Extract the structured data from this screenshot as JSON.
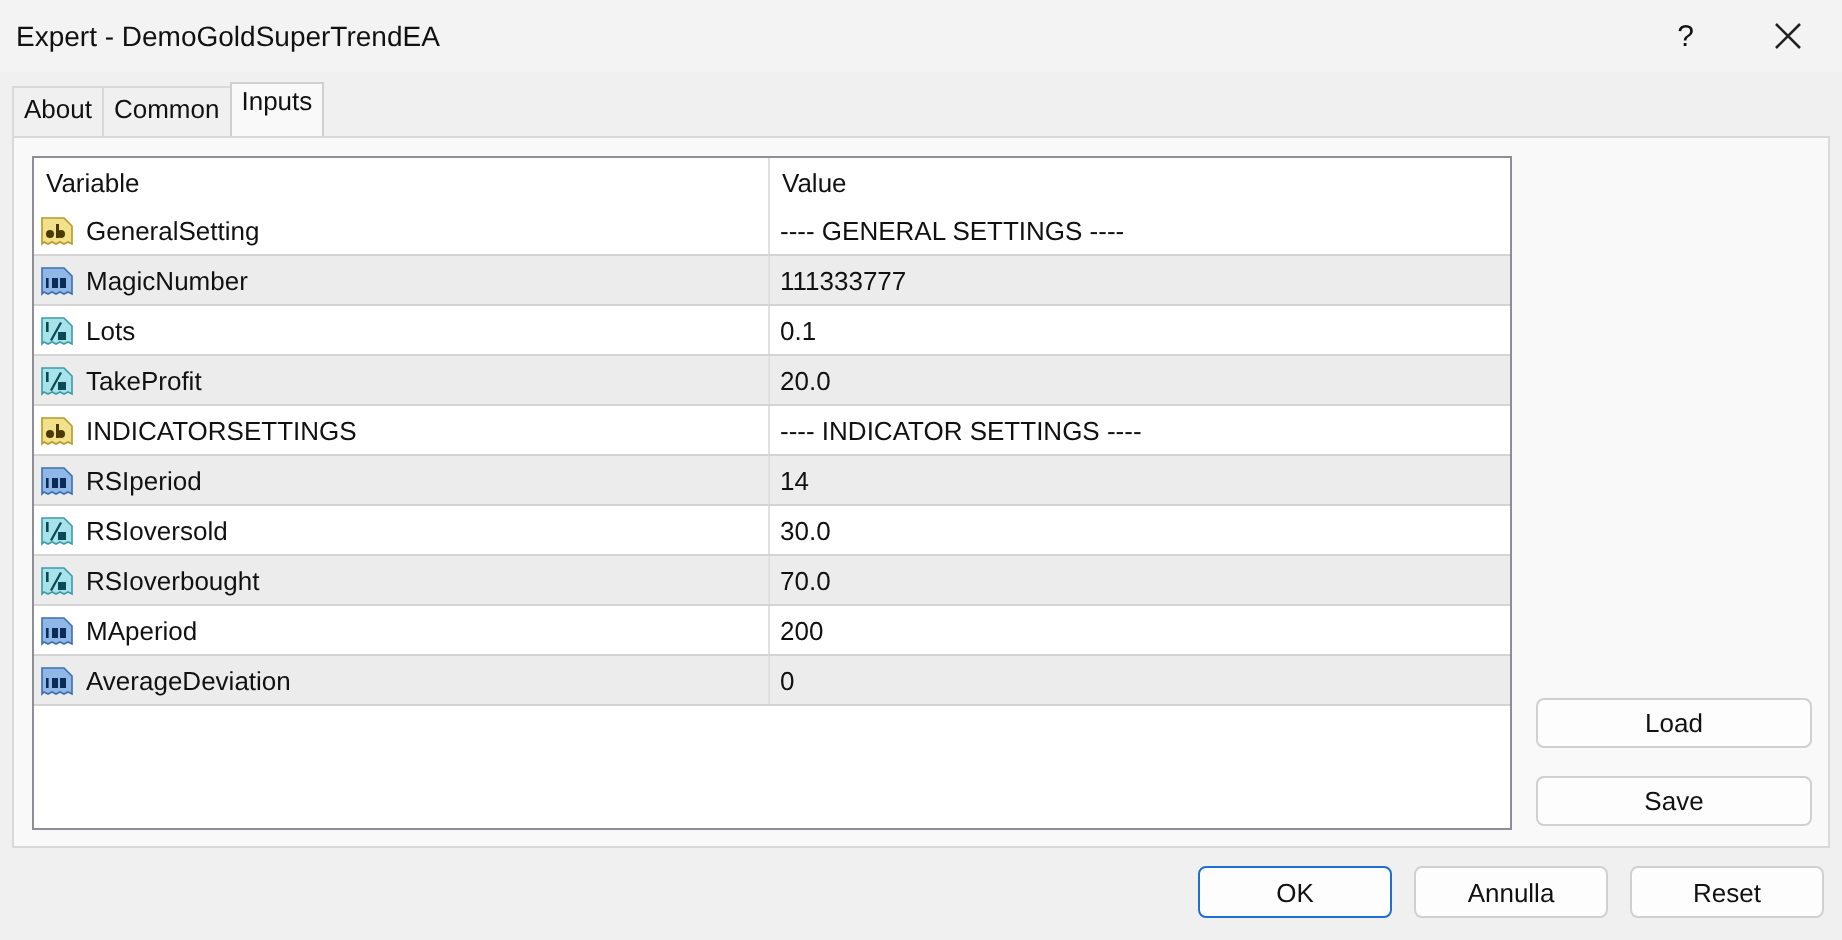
{
  "window": {
    "title": "Expert - DemoGoldSuperTrendEA",
    "help": "?"
  },
  "tabs": [
    {
      "label": "About",
      "selected": false
    },
    {
      "label": "Common",
      "selected": false
    },
    {
      "label": "Inputs",
      "selected": true
    }
  ],
  "table": {
    "columns": [
      "Variable",
      "Value"
    ],
    "rows": [
      {
        "kind": "string",
        "variable": "GeneralSetting",
        "value": "---- GENERAL SETTINGS ----"
      },
      {
        "kind": "int",
        "variable": "MagicNumber",
        "value": "111333777"
      },
      {
        "kind": "double",
        "variable": "Lots",
        "value": "0.1"
      },
      {
        "kind": "double",
        "variable": "TakeProfit",
        "value": "20.0"
      },
      {
        "kind": "string",
        "variable": "INDICATORSETTINGS",
        "value": "---- INDICATOR SETTINGS ----"
      },
      {
        "kind": "int",
        "variable": "RSIperiod",
        "value": "14"
      },
      {
        "kind": "double",
        "variable": "RSIoversold",
        "value": "30.0"
      },
      {
        "kind": "double",
        "variable": "RSIoverbought",
        "value": "70.0"
      },
      {
        "kind": "int",
        "variable": "MAperiod",
        "value": "200"
      },
      {
        "kind": "int",
        "variable": "AverageDeviation",
        "value": "0"
      }
    ]
  },
  "side_buttons": [
    "Load",
    "Save"
  ],
  "buttons": [
    {
      "label": "OK",
      "default": true
    },
    {
      "label": "Annulla",
      "default": false
    },
    {
      "label": "Reset",
      "default": false
    }
  ]
}
